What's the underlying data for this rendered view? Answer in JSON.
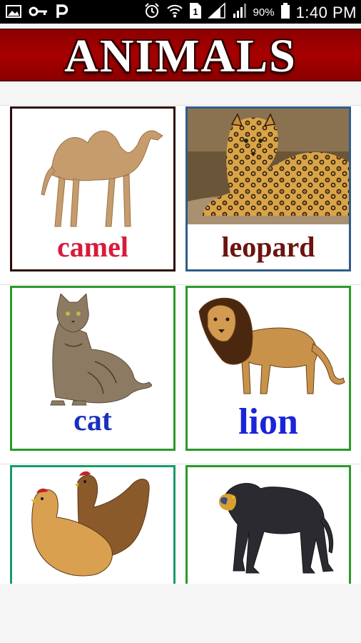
{
  "status_bar": {
    "battery_percent": "90%",
    "time": "1:40 PM",
    "left_icons": [
      "image-icon",
      "key-icon",
      "p-icon"
    ],
    "right_icons": [
      "alarm-icon",
      "wifi-icon",
      "sim-1-icon",
      "signal-icon",
      "signal-icon-2",
      "battery-icon"
    ]
  },
  "header": {
    "title": "ANIMALS",
    "background": "#a00000"
  },
  "cards": [
    {
      "label": "camel",
      "label_color": "#d81b3c",
      "border_color": "#2b0a0a"
    },
    {
      "label": "leopard",
      "label_color": "#6b1410",
      "border_color": "#2f5d8a"
    },
    {
      "label": "cat",
      "label_color": "#1a2fc0",
      "border_color": "#2a9a2a"
    },
    {
      "label": "lion",
      "label_color": "#1a24d8",
      "border_color": "#2a9a2a"
    },
    {
      "label": "",
      "label_color": "#000000",
      "border_color": "#1a9a6a"
    },
    {
      "label": "",
      "label_color": "#000000",
      "border_color": "#2a9a2a"
    }
  ]
}
